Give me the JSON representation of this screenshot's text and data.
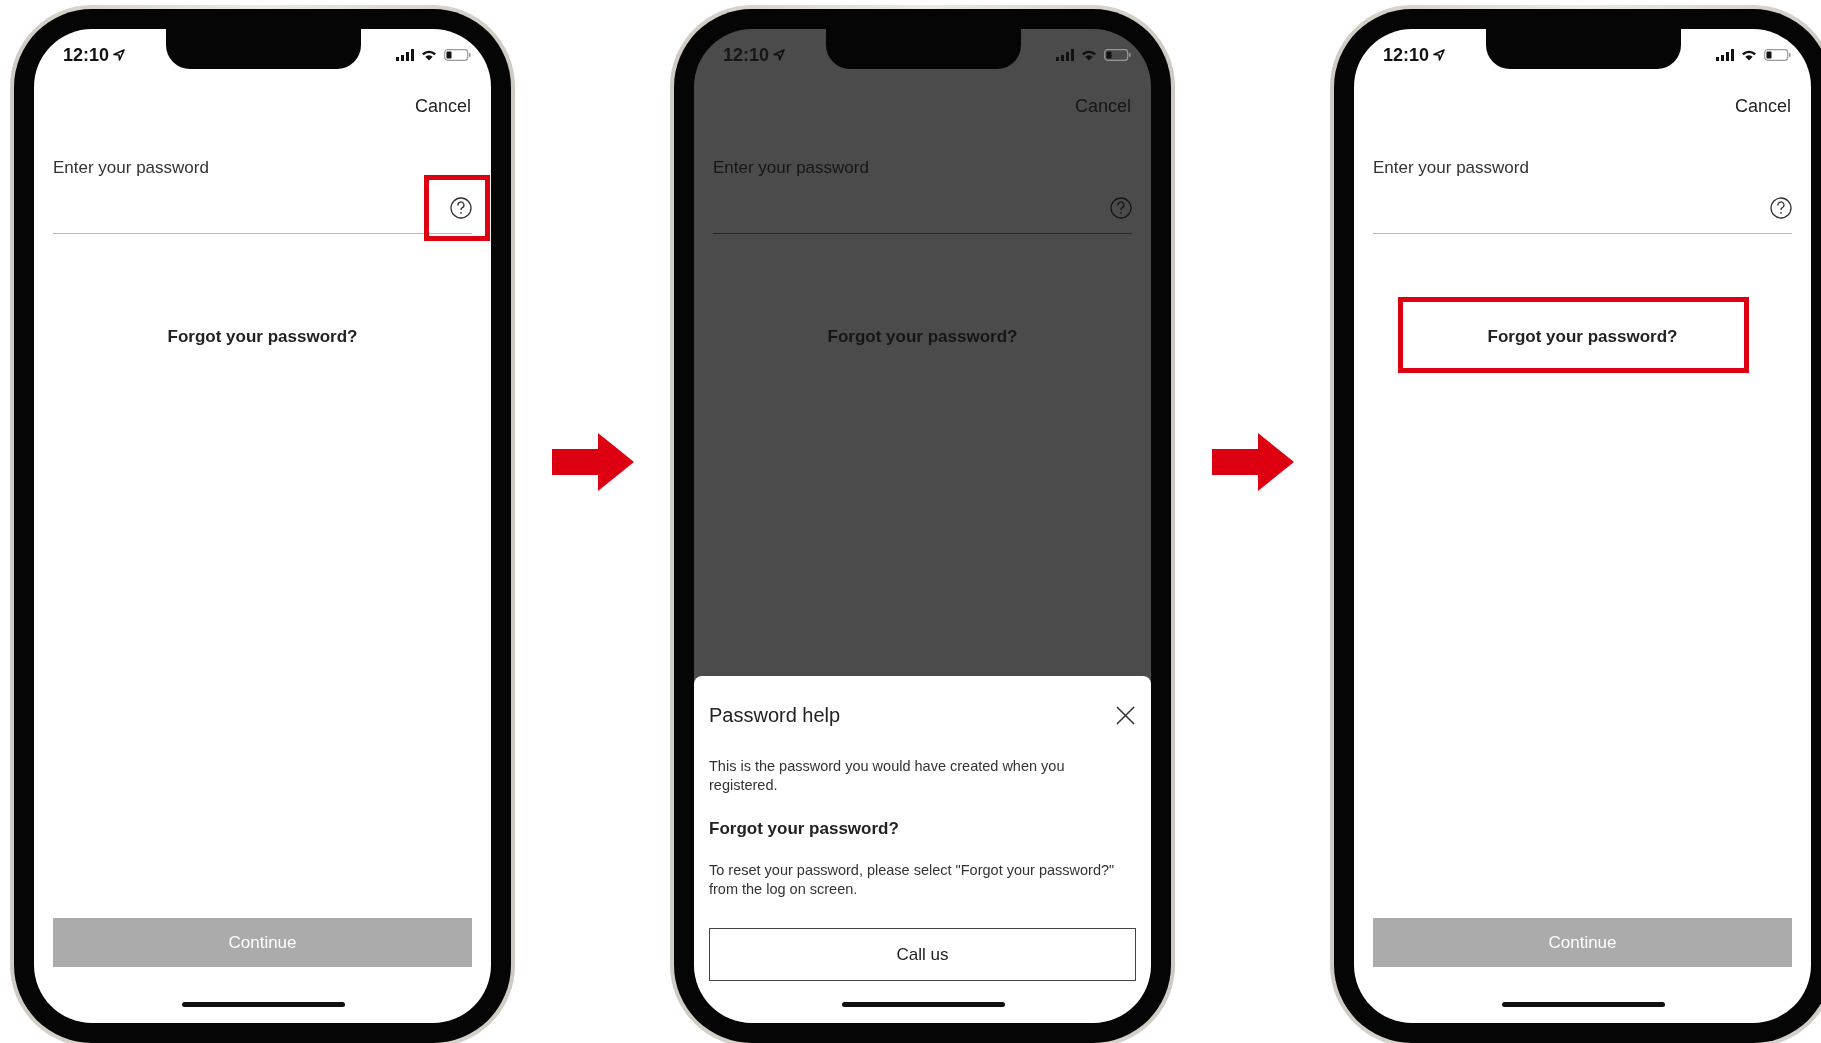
{
  "screens": [
    {
      "status_bar": {
        "time": "12:10"
      },
      "cancel": "Cancel",
      "password_field": {
        "label": "Enter your password",
        "highlighted": true
      },
      "forgot_link": {
        "label": "Forgot your password?",
        "highlighted": false
      },
      "continue_button": {
        "label": "Continue",
        "disabled": true
      },
      "dimmed": false
    },
    {
      "status_bar": {
        "time": "12:10"
      },
      "cancel": "Cancel",
      "password_field": {
        "label": "Enter your password",
        "highlighted": false
      },
      "forgot_link": {
        "label": "Forgot your password?",
        "highlighted": false
      },
      "dimmed": true,
      "sheet": {
        "title": "Password help",
        "intro": "This is the password you would have created when you registered.",
        "heading": "Forgot your password?",
        "body": "To reset your password, please select \"Forgot your password?\" from the log on screen.",
        "button": "Call us"
      }
    },
    {
      "status_bar": {
        "time": "12:10"
      },
      "cancel": "Cancel",
      "password_field": {
        "label": "Enter your password",
        "highlighted": false
      },
      "forgot_link": {
        "label": "Forgot your password?",
        "highlighted": true
      },
      "continue_button": {
        "label": "Continue",
        "disabled": true
      },
      "dimmed": false
    }
  ]
}
